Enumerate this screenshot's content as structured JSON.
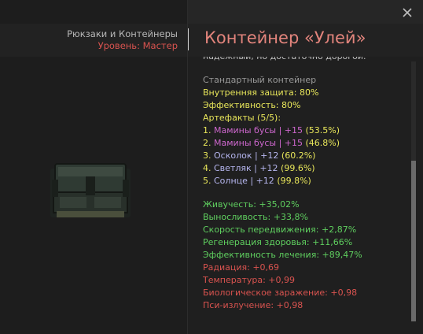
{
  "header": {
    "category": "Рюкзаки и Контейнеры",
    "level_label": "Уровень:",
    "level_value": "Мастер"
  },
  "item": {
    "title": "Контейнер «Улей»",
    "cut_text": "надежный, но достаточно дорогой.",
    "type": "Стандартный контейнер",
    "internal_protection": "Внутренняя защита: 80%",
    "efficiency": "Эффективность: 80%",
    "artifacts_header": "Артефакты (5/5):",
    "artifacts": [
      {
        "num": "1.",
        "name": "Мамины бусы | +15",
        "pct": "(53.5%)"
      },
      {
        "num": "2.",
        "name": "Мамины бусы | +15",
        "pct": "(46.8%)"
      },
      {
        "num": "3.",
        "name": "Осколок | +12",
        "pct": "(60.2%)"
      },
      {
        "num": "4.",
        "name": "Светляк | +12",
        "pct": "(99.6%)"
      },
      {
        "num": "5.",
        "name": "Солнце | +12",
        "pct": "(99.8%)"
      }
    ],
    "positive_stats": [
      "Живучесть: +35,02%",
      "Выносливость: +33,8%",
      "Скорость передвижения: +2,87%",
      "Регенерация здоровья: +11,66%",
      "Эффективность лечения: +89,47%"
    ],
    "negative_stats": [
      "Радиация: +0,69",
      "Температура: +0,99",
      "Биологическое заражение: +0,98",
      "Пси-излучение: +0,98"
    ]
  },
  "colors": {
    "title": "#e2847c",
    "gray": "#9a9a9a",
    "yellow": "#e8e65a",
    "pink": "#cc66cc",
    "blue": "#b7b7f0",
    "green": "#5fcf5f",
    "red": "#d9534f"
  },
  "icons": {
    "close": "close-icon",
    "item": "container-item-image"
  }
}
